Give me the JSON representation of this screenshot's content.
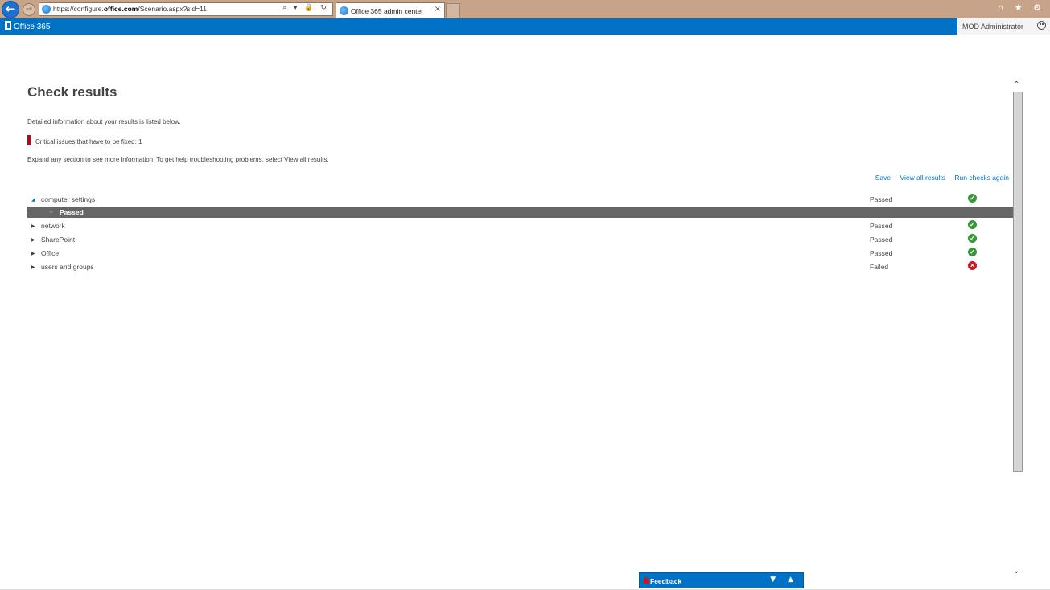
{
  "browser": {
    "back_glyph": "←",
    "forward_glyph": "→",
    "url_prefix": "https://configure.",
    "url_domain": "office.com",
    "url_path": "/Scenario.aspx?sid=11",
    "address_icons": "⌕ ▾ 🔒 ↻",
    "tab_title": "Office 365 admin center",
    "tab_close": "×",
    "right_icons": "⌂ ★ ⚙"
  },
  "suitebar": {
    "logo_text": "Office 365",
    "user_name": "MOD Administrator"
  },
  "page": {
    "title": "Check results",
    "description": "Detailed information about your results is listed below.",
    "critical_text": "Critical issues that have to be fixed: 1",
    "expand_info": "Expand any section to see more information. To get help troubleshooting problems, select View all results."
  },
  "actions": {
    "save": "Save",
    "view_all": "View all results",
    "run_again": "Run checks again"
  },
  "results": [
    {
      "label": "computer settings",
      "status": "Passed",
      "state": "ok",
      "expanded": true,
      "children": [
        {
          "label": "Passed"
        }
      ]
    },
    {
      "label": "network",
      "status": "Passed",
      "state": "ok"
    },
    {
      "label": "SharePoint",
      "status": "Passed",
      "state": "ok"
    },
    {
      "label": "Office",
      "status": "Passed",
      "state": "ok"
    },
    {
      "label": "users and groups",
      "status": "Failed",
      "state": "fail"
    }
  ],
  "icons": {
    "expanded_arrow": "◢",
    "collapsed_arrow": "▶",
    "ok_glyph": "✓",
    "fail_glyph": "×",
    "scroll_up": "⌃",
    "scroll_down": "⌄"
  },
  "feedback": {
    "label": "Feedback",
    "controls": "▼ ▲"
  },
  "colors": {
    "brand_blue": "#0072c6",
    "passed_green": "#3c963c",
    "failed_red": "#d0141c",
    "critical_red": "#a4131a"
  }
}
